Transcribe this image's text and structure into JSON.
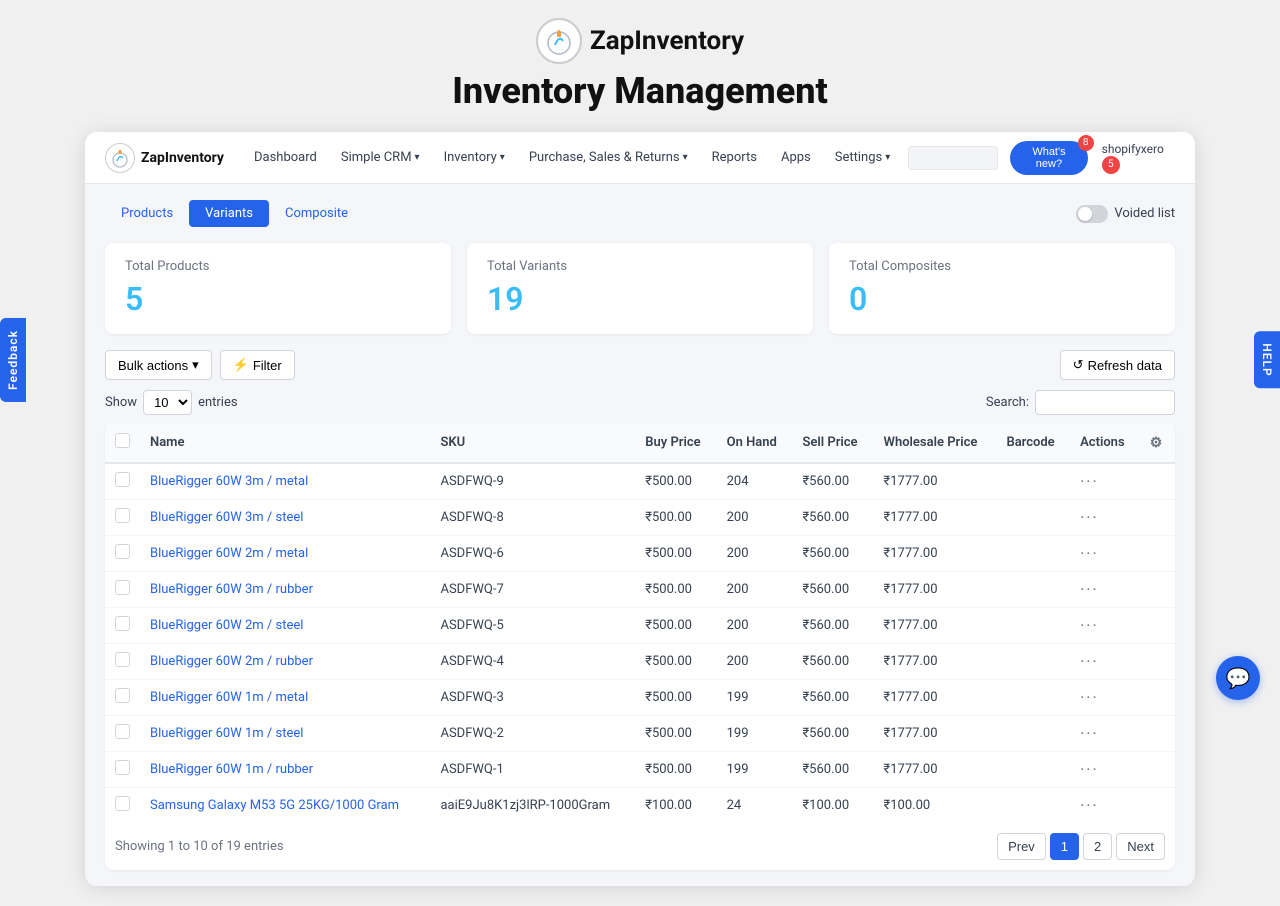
{
  "branding": {
    "app_name": "ZapInventory",
    "page_title": "Inventory Management",
    "logo_icon": "🧮"
  },
  "navbar": {
    "brand": "ZapInventory",
    "items": [
      {
        "label": "Dashboard",
        "has_dropdown": false
      },
      {
        "label": "Simple CRM",
        "has_dropdown": true
      },
      {
        "label": "Inventory",
        "has_dropdown": true
      },
      {
        "label": "Purchase, Sales & Returns",
        "has_dropdown": true
      },
      {
        "label": "Reports",
        "has_dropdown": false
      },
      {
        "label": "Apps",
        "has_dropdown": false
      },
      {
        "label": "Settings",
        "has_dropdown": true
      }
    ],
    "search_placeholder": "",
    "whats_new_label": "What's new?",
    "whats_new_badge": "8",
    "user_label": "shopifyxero",
    "user_badge": "5"
  },
  "tabs": [
    {
      "label": "Products",
      "active": false
    },
    {
      "label": "Variants",
      "active": true
    },
    {
      "label": "Composite",
      "active": false
    }
  ],
  "voided_list_label": "Voided list",
  "stats": [
    {
      "label": "Total Products",
      "value": "5"
    },
    {
      "label": "Total Variants",
      "value": "19"
    },
    {
      "label": "Total Composites",
      "value": "0"
    }
  ],
  "toolbar": {
    "bulk_actions_label": "Bulk actions",
    "filter_label": "Filter",
    "refresh_label": "Refresh data"
  },
  "table": {
    "show_label": "Show",
    "show_value": "10",
    "entries_label": "entries",
    "search_label": "Search:",
    "columns": [
      "Name",
      "SKU",
      "Buy Price",
      "On Hand",
      "Sell Price",
      "Wholesale Price",
      "Barcode",
      "Actions"
    ],
    "rows": [
      {
        "name": "BlueRigger 60W 3m / metal",
        "sku": "ASDFWQ-9",
        "buy_price": "₹500.00",
        "on_hand": "204",
        "sell_price": "₹560.00",
        "wholesale_price": "₹1777.00",
        "barcode": "",
        "actions": "···"
      },
      {
        "name": "BlueRigger 60W 3m / steel",
        "sku": "ASDFWQ-8",
        "buy_price": "₹500.00",
        "on_hand": "200",
        "sell_price": "₹560.00",
        "wholesale_price": "₹1777.00",
        "barcode": "",
        "actions": "···"
      },
      {
        "name": "BlueRigger 60W 2m / metal",
        "sku": "ASDFWQ-6",
        "buy_price": "₹500.00",
        "on_hand": "200",
        "sell_price": "₹560.00",
        "wholesale_price": "₹1777.00",
        "barcode": "",
        "actions": "···"
      },
      {
        "name": "BlueRigger 60W 3m / rubber",
        "sku": "ASDFWQ-7",
        "buy_price": "₹500.00",
        "on_hand": "200",
        "sell_price": "₹560.00",
        "wholesale_price": "₹1777.00",
        "barcode": "",
        "actions": "···"
      },
      {
        "name": "BlueRigger 60W 2m / steel",
        "sku": "ASDFWQ-5",
        "buy_price": "₹500.00",
        "on_hand": "200",
        "sell_price": "₹560.00",
        "wholesale_price": "₹1777.00",
        "barcode": "",
        "actions": "···"
      },
      {
        "name": "BlueRigger 60W 2m / rubber",
        "sku": "ASDFWQ-4",
        "buy_price": "₹500.00",
        "on_hand": "200",
        "sell_price": "₹560.00",
        "wholesale_price": "₹1777.00",
        "barcode": "",
        "actions": "···"
      },
      {
        "name": "BlueRigger 60W 1m / metal",
        "sku": "ASDFWQ-3",
        "buy_price": "₹500.00",
        "on_hand": "199",
        "sell_price": "₹560.00",
        "wholesale_price": "₹1777.00",
        "barcode": "",
        "actions": "···"
      },
      {
        "name": "BlueRigger 60W 1m / steel",
        "sku": "ASDFWQ-2",
        "buy_price": "₹500.00",
        "on_hand": "199",
        "sell_price": "₹560.00",
        "wholesale_price": "₹1777.00",
        "barcode": "",
        "actions": "···"
      },
      {
        "name": "BlueRigger 60W 1m / rubber",
        "sku": "ASDFWQ-1",
        "buy_price": "₹500.00",
        "on_hand": "199",
        "sell_price": "₹560.00",
        "wholesale_price": "₹1777.00",
        "barcode": "",
        "actions": "···"
      },
      {
        "name": "Samsung Galaxy M53 5G 25KG/1000 Gram",
        "sku": "aaiE9Ju8K1zj3lRP-1000Gram",
        "buy_price": "₹100.00",
        "on_hand": "24",
        "sell_price": "₹100.00",
        "wholesale_price": "₹100.00",
        "barcode": "",
        "actions": "···"
      }
    ]
  },
  "pagination": {
    "showing_text": "Showing 1 to 10 of 19 entries",
    "prev_label": "Prev",
    "next_label": "Next",
    "pages": [
      "1",
      "2"
    ],
    "active_page": "1"
  },
  "side": {
    "help_label": "HELP",
    "feedback_label": "Feedback",
    "chat_icon": "💬"
  }
}
